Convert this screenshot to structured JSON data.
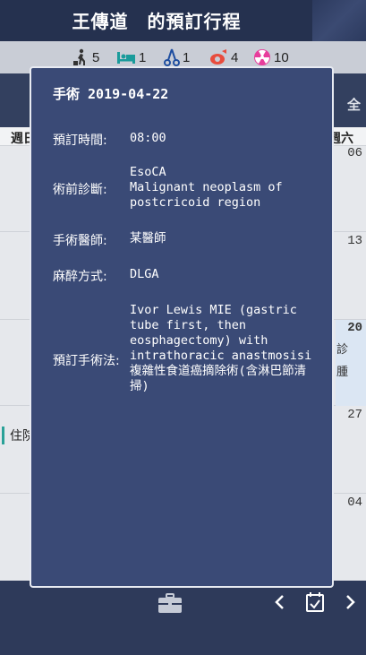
{
  "header": {
    "title": "王傳道　的預訂行程"
  },
  "stats": [
    {
      "icon": "walking-person-icon",
      "value": "5"
    },
    {
      "icon": "hospital-bed-icon",
      "value": "1"
    },
    {
      "icon": "surgical-scissors-icon",
      "value": "1"
    },
    {
      "icon": "anesthesia-icon",
      "value": "4"
    },
    {
      "icon": "radiation-icon",
      "value": "10"
    }
  ],
  "calendar": {
    "all_label": "全",
    "week_left": "週日",
    "week_right": "週六",
    "days": [
      "06",
      "13",
      "20",
      "27",
      "04"
    ],
    "side_text_1": "診",
    "side_text_2": "腫",
    "event_tag": "住院"
  },
  "popup": {
    "title": "手術 2019-04-22",
    "time_label": "預訂時間:",
    "time_value": "08:00",
    "diagnosis_label": "術前診斷:",
    "diagnosis_value": "EsoCA\nMalignant neoplasm of postcricoid region",
    "doctor_label": "手術醫師:",
    "doctor_value": "某醫師",
    "anesthesia_label": "麻醉方式:",
    "anesthesia_value": "DLGA",
    "procedure_label": "預訂手術法:",
    "procedure_value": "Ivor Lewis MIE (gastric tube first, then eosphagectomy) with intrathoracic anastmosisi\n複雜性食道癌摘除術(含淋巴節清掃)"
  },
  "colors": {
    "accent": "#e84c3d",
    "radiation": "#e83d9c",
    "bed": "#1a9b9b",
    "popup_bg": "#3a4a76"
  }
}
